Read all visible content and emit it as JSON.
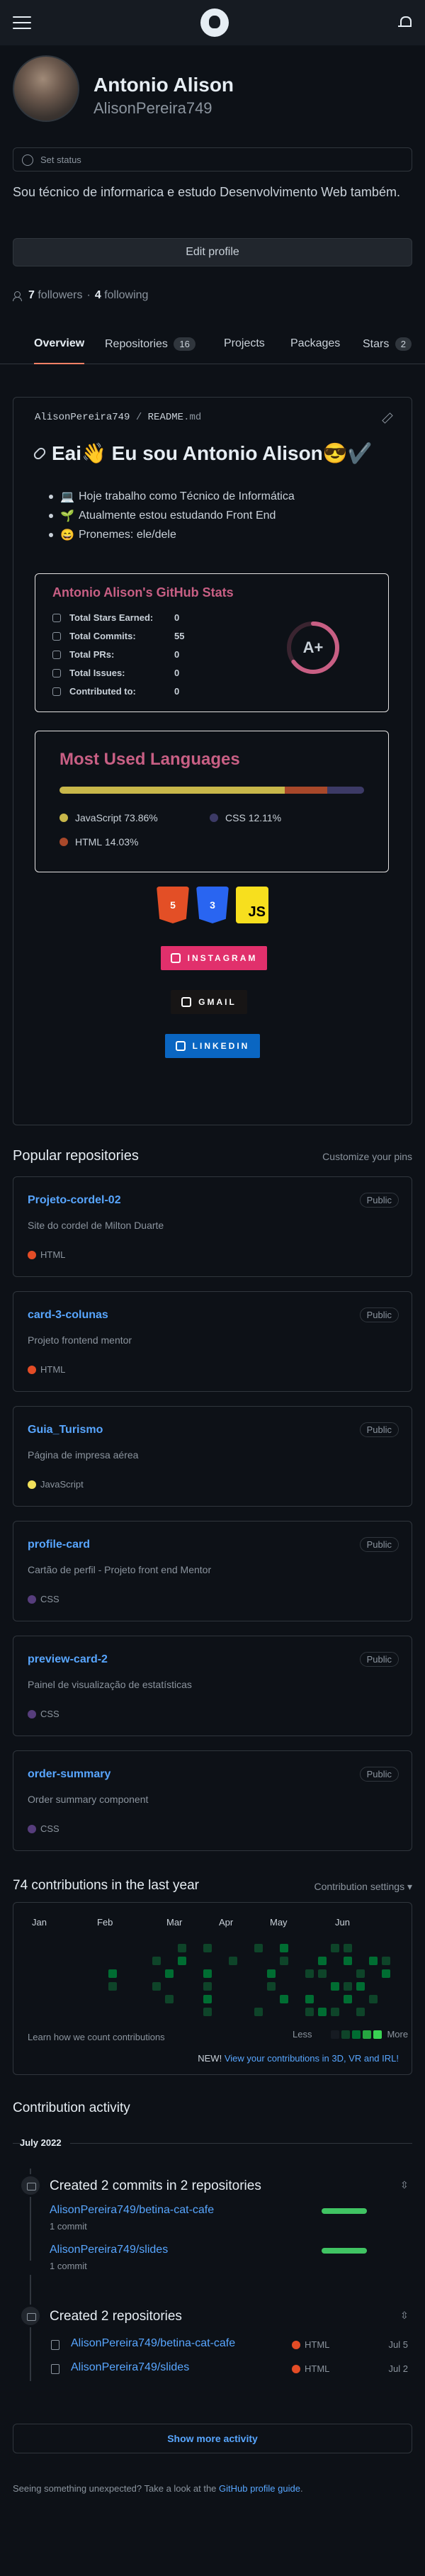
{
  "profile": {
    "name": "Antonio Alison",
    "login": "AlisonPereira749",
    "status_placeholder": "Set status",
    "bio": "Sou técnico de informarica e estudo Desenvolvimento Web também.",
    "edit_label": "Edit profile",
    "followers_count": "7",
    "followers_label": "followers",
    "following_count": "4",
    "following_label": "following"
  },
  "tabs": [
    {
      "label": "Overview",
      "count": ""
    },
    {
      "label": "Repositories",
      "count": "16"
    },
    {
      "label": "Projects",
      "count": ""
    },
    {
      "label": "Packages",
      "count": ""
    },
    {
      "label": "Stars",
      "count": "2"
    }
  ],
  "readme": {
    "owner": "AlisonPereira749",
    "separator": "/",
    "file": "README",
    "ext": ".md",
    "heading": "Eai👋 Eu sou Antonio Alison😎✔️",
    "items": [
      {
        "emoji": "💻",
        "text": "Hoje trabalho como Técnico de Informática"
      },
      {
        "emoji": "🌱",
        "text": "Atualmente estou estudando Front End"
      },
      {
        "emoji": "😄",
        "text": "Pronemes: ele/dele"
      }
    ],
    "stats": {
      "title": "Antonio Alison's GitHub Stats",
      "rows": [
        {
          "label": "Total Stars Earned:",
          "value": "0"
        },
        {
          "label": "Total Commits:",
          "value": "55"
        },
        {
          "label": "Total PRs:",
          "value": "0"
        },
        {
          "label": "Total Issues:",
          "value": "0"
        },
        {
          "label": "Contributed to:",
          "value": "0"
        }
      ],
      "grade": "A+",
      "ring_fraction": 0.65,
      "accent": "#c85f84"
    },
    "languages": {
      "title": "Most Used Languages",
      "items": [
        {
          "name": "JavaScript",
          "percent": "73.86%",
          "value": 73.86,
          "color": "#c8b74a"
        },
        {
          "name": "HTML",
          "percent": "14.03%",
          "value": 14.03,
          "color": "#a8482a"
        },
        {
          "name": "CSS",
          "percent": "12.11%",
          "value": 12.11,
          "color": "#3c3a66"
        }
      ]
    },
    "badges": [
      {
        "label": "5",
        "kind": "html5"
      },
      {
        "label": "3",
        "kind": "css3"
      },
      {
        "label": "JS",
        "kind": "javascript"
      }
    ],
    "social": [
      {
        "label": "INSTAGRAM",
        "color": "#e1306c"
      },
      {
        "label": "GMAIL",
        "color": "#171515"
      },
      {
        "label": "LINKEDIN",
        "color": "#0a66c2"
      }
    ]
  },
  "popular": {
    "title": "Popular repositories",
    "customize": "Customize your pins",
    "repos": [
      {
        "name": "Projeto-cordel-02",
        "visibility": "Public",
        "desc": "Site do cordel de Milton Duarte",
        "lang": "HTML",
        "color": "#e34c26"
      },
      {
        "name": "card-3-colunas",
        "visibility": "Public",
        "desc": "Projeto frontend mentor",
        "lang": "HTML",
        "color": "#e34c26"
      },
      {
        "name": "Guia_Turismo",
        "visibility": "Public",
        "desc": "Página de impresa aérea",
        "lang": "JavaScript",
        "color": "#f1e05a"
      },
      {
        "name": "profile-card",
        "visibility": "Public",
        "desc": "Cartão de perfil - Projeto front end Mentor",
        "lang": "CSS",
        "color": "#563d7c"
      },
      {
        "name": "preview-card-2",
        "visibility": "Public",
        "desc": "Painel de visualização de estatísticas",
        "lang": "CSS",
        "color": "#563d7c"
      },
      {
        "name": "order-summary",
        "visibility": "Public",
        "desc": "Order summary component",
        "lang": "CSS",
        "color": "#563d7c"
      }
    ]
  },
  "contributions": {
    "title": "74 contributions in the last year",
    "settings": "Contribution settings ▾",
    "months": [
      "Jan",
      "Feb",
      "Mar",
      "Apr",
      "May",
      "Jun"
    ],
    "learn": "Learn how we count contributions",
    "less": "Less",
    "more": "More",
    "news_prefix": "NEW!",
    "news_link": "View your contributions in 3D, VR and IRL!",
    "legend_colors": [
      "#161b22",
      "#0e4429",
      "#006d32",
      "#26a641",
      "#39d353"
    ]
  },
  "activity": {
    "title": "Contribution activity",
    "month": "July 2022",
    "commits_head": "Created 2 commits in 2 repositories",
    "commits": [
      {
        "repo": "AlisonPereira749/betina-cat-cafe",
        "count": "1 commit"
      },
      {
        "repo": "AlisonPereira749/slides",
        "count": "1 commit"
      }
    ],
    "repos_head": "Created 2 repositories",
    "repos": [
      {
        "name": "AlisonPereira749/betina-cat-cafe",
        "lang": "HTML",
        "date": "Jul 5"
      },
      {
        "name": "AlisonPereira749/slides",
        "lang": "HTML",
        "date": "Jul 2"
      }
    ],
    "more": "Show more activity"
  },
  "footer": {
    "text": "Seeing something unexpected? Take a look at the",
    "link": "GitHub profile guide",
    "end": "."
  }
}
